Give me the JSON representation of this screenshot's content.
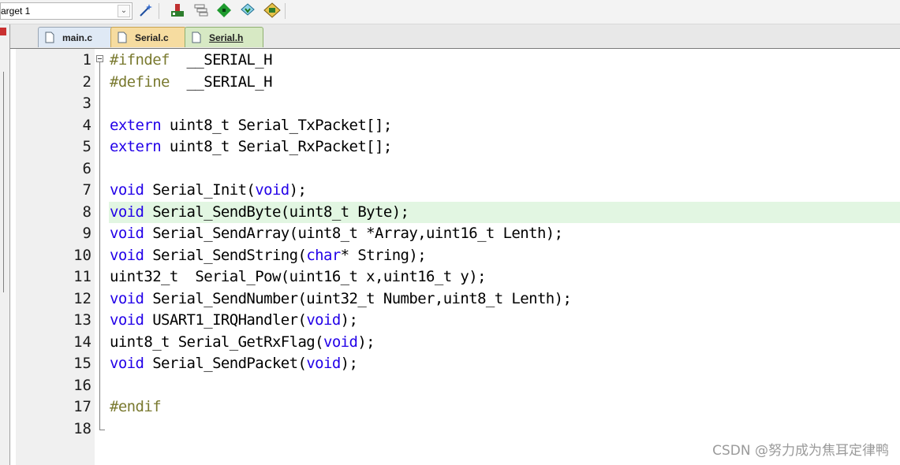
{
  "toolbar": {
    "target_value": "arget 1",
    "icons": [
      "dropdown-chevron-icon",
      "magic-wand-icon",
      "load-flash-icon",
      "stack-icon",
      "diamond-green-icon",
      "diamond-download-icon",
      "chip-config-icon"
    ]
  },
  "tabs": [
    {
      "label": "main.c",
      "active": false
    },
    {
      "label": "Serial.c",
      "active": false
    },
    {
      "label": "Serial.h",
      "active": true
    }
  ],
  "editor": {
    "highlighted_line": 8,
    "lines": [
      {
        "n": "1",
        "tokens": [
          {
            "t": "#ifndef",
            "c": "pp"
          },
          {
            "t": "  __SERIAL_H",
            "c": "txt"
          }
        ]
      },
      {
        "n": "2",
        "tokens": [
          {
            "t": "#define",
            "c": "pp"
          },
          {
            "t": "  __SERIAL_H",
            "c": "txt"
          }
        ]
      },
      {
        "n": "3",
        "tokens": []
      },
      {
        "n": "4",
        "tokens": [
          {
            "t": "extern",
            "c": "kw"
          },
          {
            "t": " uint8_t Serial_TxPacket[];",
            "c": "txt"
          }
        ]
      },
      {
        "n": "5",
        "tokens": [
          {
            "t": "extern",
            "c": "kw"
          },
          {
            "t": " uint8_t Serial_RxPacket[];",
            "c": "txt"
          }
        ]
      },
      {
        "n": "6",
        "tokens": []
      },
      {
        "n": "7",
        "tokens": [
          {
            "t": "void",
            "c": "kw"
          },
          {
            "t": " Serial_Init(",
            "c": "txt"
          },
          {
            "t": "void",
            "c": "kw"
          },
          {
            "t": ");",
            "c": "txt"
          }
        ]
      },
      {
        "n": "8",
        "tokens": [
          {
            "t": "void",
            "c": "kw"
          },
          {
            "t": " Serial_SendByte(uint8_t Byte);",
            "c": "txt"
          }
        ]
      },
      {
        "n": "9",
        "tokens": [
          {
            "t": "void",
            "c": "kw"
          },
          {
            "t": " Serial_SendArray(uint8_t *Array,uint16_t Lenth);",
            "c": "txt"
          }
        ]
      },
      {
        "n": "10",
        "tokens": [
          {
            "t": "void",
            "c": "kw"
          },
          {
            "t": " Serial_SendString(",
            "c": "txt"
          },
          {
            "t": "char",
            "c": "kw"
          },
          {
            "t": "* String);",
            "c": "txt"
          }
        ]
      },
      {
        "n": "11",
        "tokens": [
          {
            "t": "uint32_t  Serial_Pow(uint16_t x,uint16_t y);",
            "c": "txt"
          }
        ]
      },
      {
        "n": "12",
        "tokens": [
          {
            "t": "void",
            "c": "kw"
          },
          {
            "t": " Serial_SendNumber(uint32_t Number,uint8_t Lenth);",
            "c": "txt"
          }
        ]
      },
      {
        "n": "13",
        "tokens": [
          {
            "t": "void",
            "c": "kw"
          },
          {
            "t": " USART1_IRQHandler(",
            "c": "txt"
          },
          {
            "t": "void",
            "c": "kw"
          },
          {
            "t": ");",
            "c": "txt"
          }
        ]
      },
      {
        "n": "14",
        "tokens": [
          {
            "t": "uint8_t Serial_GetRxFlag(",
            "c": "txt"
          },
          {
            "t": "void",
            "c": "kw"
          },
          {
            "t": ");",
            "c": "txt"
          }
        ]
      },
      {
        "n": "15",
        "tokens": [
          {
            "t": "void",
            "c": "kw"
          },
          {
            "t": " Serial_SendPacket(",
            "c": "txt"
          },
          {
            "t": "void",
            "c": "kw"
          },
          {
            "t": ");",
            "c": "txt"
          }
        ]
      },
      {
        "n": "16",
        "tokens": []
      },
      {
        "n": "17",
        "tokens": [
          {
            "t": "#endif",
            "c": "pp"
          }
        ]
      },
      {
        "n": "18",
        "tokens": []
      }
    ]
  },
  "watermark": "CSDN @努力成为焦耳定律鸭",
  "colors": {
    "keyword": "#2200e8",
    "preprocessor": "#7a7a30",
    "highlight": "#e2f6e2"
  }
}
